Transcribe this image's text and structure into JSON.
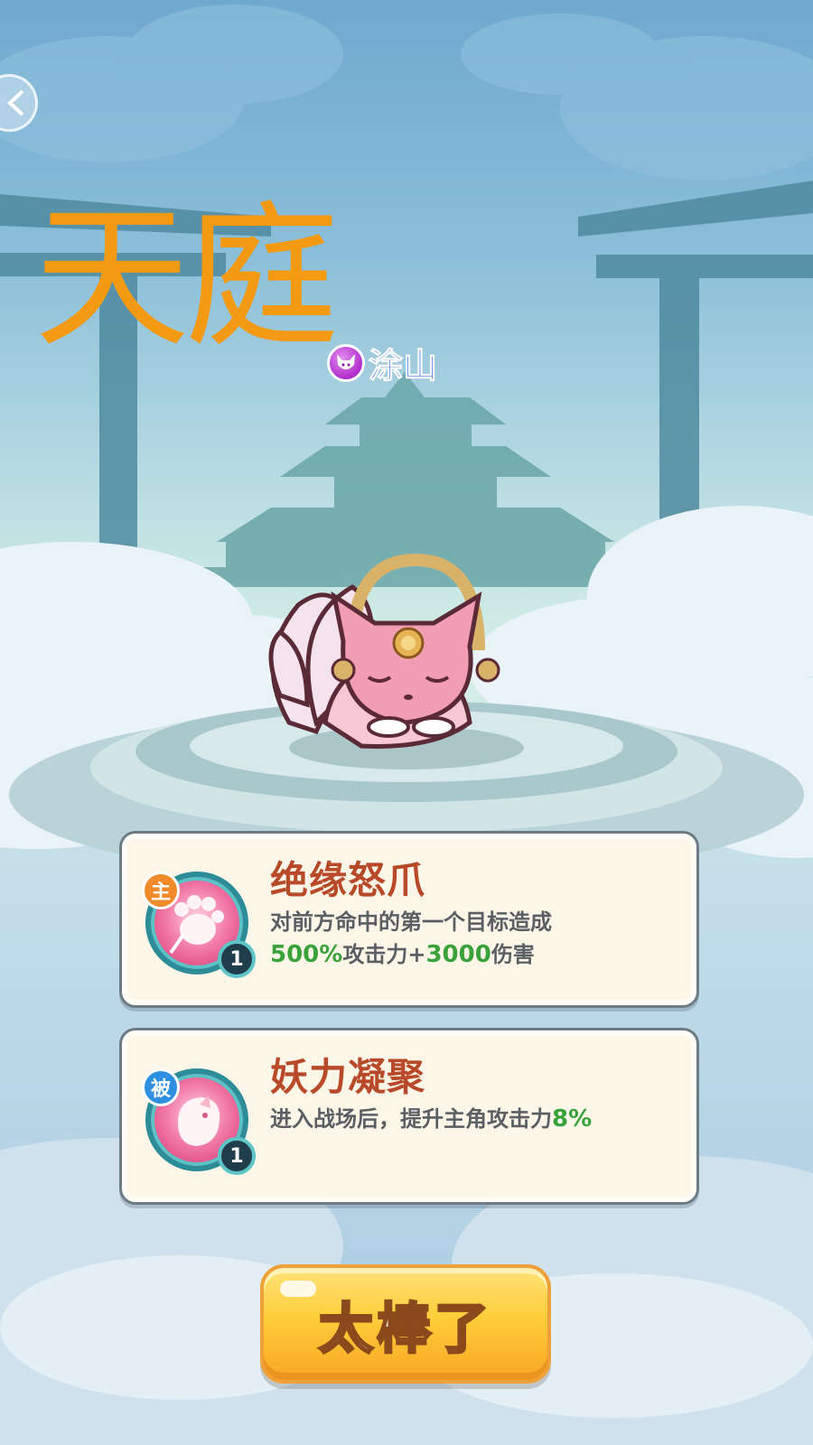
{
  "realm": {
    "title": "天庭"
  },
  "faction": {
    "icon": "fox-face-icon",
    "name": "涂山",
    "color": "#2f5fd6"
  },
  "skills": [
    {
      "type_badge": "主",
      "level": "1",
      "icon": "paw-icon",
      "name": "绝缘怒爪",
      "desc_line1": "对前方命中的第一个目标造成",
      "desc_value1": "500%",
      "desc_text1": "攻击力+",
      "desc_value2": "3000",
      "desc_text2": "伤害"
    },
    {
      "type_badge": "被",
      "level": "1",
      "icon": "fox-spirit-icon",
      "name": "妖力凝聚",
      "desc_text": "进入战场后，提升主角攻击力",
      "desc_value": "8%"
    }
  ],
  "confirm_button": {
    "label": "太棒了"
  },
  "colors": {
    "title": "#f39a12",
    "skill_name": "#b84a2a",
    "highlight": "#3aa23a",
    "button": "#ffcd3a"
  }
}
